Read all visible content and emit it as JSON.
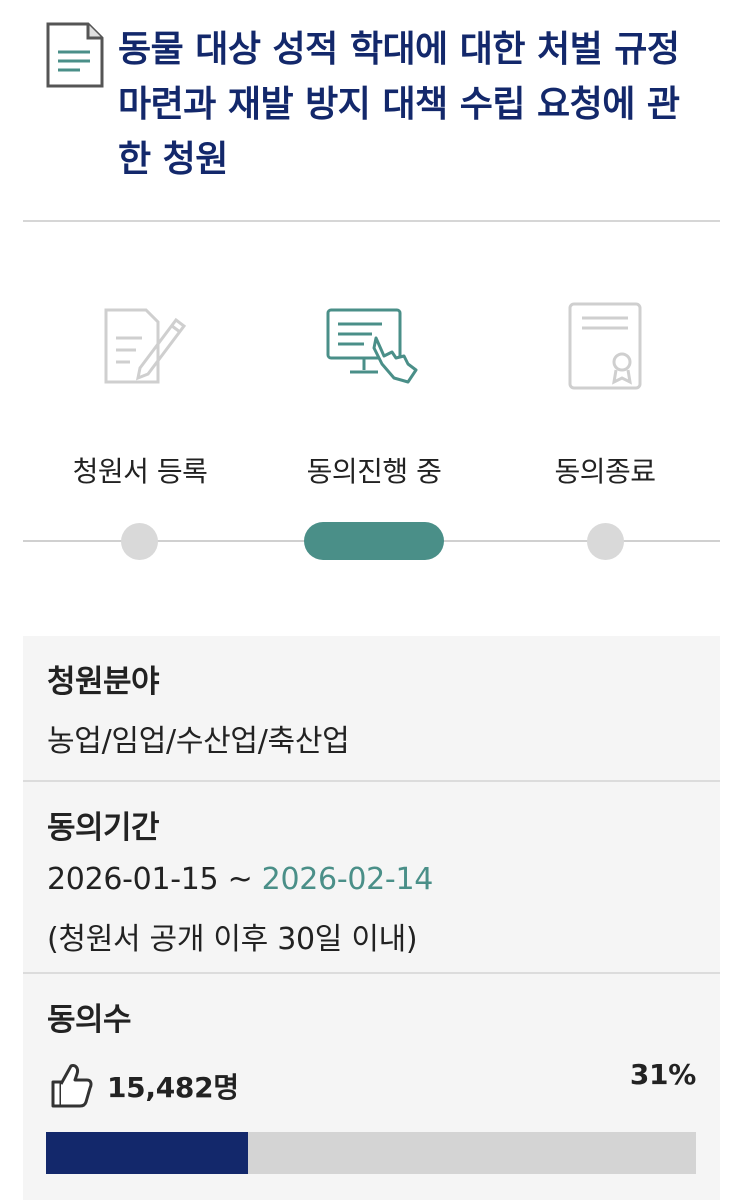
{
  "petition": {
    "title": "동물 대상 성적 학대에 대한 처벌 규정 마련과 재발 방지 대책 수립 요청에 관한 청원"
  },
  "steps": [
    {
      "label": "청원서 등록",
      "icon": "document-pen-icon",
      "active": false
    },
    {
      "label": "동의진행 중",
      "icon": "monitor-touch-icon",
      "active": true
    },
    {
      "label": "동의종료",
      "icon": "certificate-icon",
      "active": false
    }
  ],
  "colors": {
    "title": "#13286b",
    "accent": "#4a8f88",
    "progress": "#13286b"
  },
  "field": {
    "label": "청원분야",
    "value": "농업/임업/수산업/축산업"
  },
  "period": {
    "label": "동의기간",
    "start": "2026-01-15",
    "separator": " ~ ",
    "end": "2026-02-14",
    "note": "(청원서 공개 이후 30일 이내)"
  },
  "consent": {
    "label": "동의수",
    "count": "15,482명",
    "percent_text": "31%",
    "progress_fraction": 0.31,
    "icon": "thumbs-up-icon"
  }
}
